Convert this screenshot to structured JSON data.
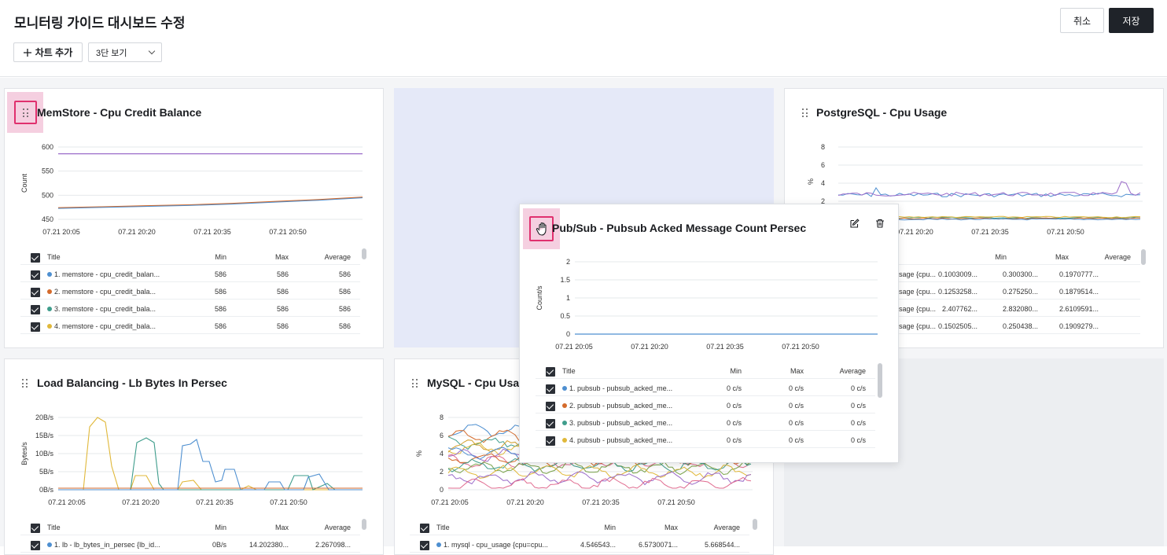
{
  "header": {
    "title": "모니터링 가이드 대시보드 수정",
    "cancel_label": "취소",
    "save_label": "저장"
  },
  "toolbar": {
    "add_chart_label": "차트 추가",
    "add_icon": "plus-icon",
    "view_select_value": "3단 보기"
  },
  "colors": {
    "accent": "#1f2329",
    "highlight": "#e0306e",
    "placeholder": "#e5e9f8",
    "series": [
      "#4e8fd0",
      "#d46b2c",
      "#3f9d8c",
      "#e0b83a",
      "#9b6cc9"
    ]
  },
  "cards": {
    "memstore": {
      "title": "MemStore - Cpu Credit Balance",
      "chart_data": {
        "type": "line",
        "ylabel": "Count",
        "y_ticks": [
          "600",
          "550",
          "500",
          "450"
        ],
        "x_ticks": [
          "07.21 20:05",
          "07.21 20:20",
          "07.21 20:35",
          "07.21 20:50"
        ],
        "ylim": [
          450,
          600
        ],
        "series": [
          {
            "name": "1. memstore - cpu_credit_balan...",
            "values": [
              586,
              586,
              586,
              586,
              586,
              586,
              586,
              586
            ]
          },
          {
            "name": "2. memstore - cpu_credit_bala...",
            "values": [
              474,
              476,
              478,
              480,
              483,
              487,
              491,
              496
            ]
          }
        ]
      },
      "table": {
        "headers": [
          "Title",
          "Min",
          "Max",
          "Average"
        ],
        "rows": [
          [
            "1. memstore - cpu_credit_balan...",
            "586",
            "586",
            "586"
          ],
          [
            "2. memstore - cpu_credit_bala...",
            "586",
            "586",
            "586"
          ],
          [
            "3. memstore - cpu_credit_bala...",
            "586",
            "586",
            "586"
          ],
          [
            "4. memstore - cpu_credit_bala...",
            "586",
            "586",
            "586"
          ]
        ]
      }
    },
    "postgres": {
      "title": "PostgreSQL - Cpu Usage",
      "chart_data": {
        "type": "line",
        "ylabel": "%",
        "y_ticks": [
          "8",
          "6",
          "4",
          "2"
        ],
        "x_ticks": [
          "07.21 20:20",
          "07.21 20:35",
          "07.21 20:50"
        ],
        "ylim": [
          0,
          8
        ]
      },
      "table": {
        "headers": [
          "Min",
          "Max",
          "Average"
        ],
        "rows": [
          [
            "usage {cpu...",
            "0.1003009...",
            "0.300300...",
            "0.1970777..."
          ],
          [
            "usage {cpu...",
            "0.1253258...",
            "0.275250...",
            "0.1879514..."
          ],
          [
            "usage {cpu...",
            "2.407762...",
            "2.832080...",
            "2.6109591..."
          ],
          [
            "usage {cpu...",
            "0.1502505...",
            "0.250438...",
            "0.1909279..."
          ]
        ]
      }
    },
    "lb": {
      "title": "Load Balancing - Lb Bytes In Persec",
      "chart_data": {
        "type": "line",
        "ylabel": "Bytes/s",
        "y_ticks": [
          "20B/s",
          "15B/s",
          "10B/s",
          "5B/s",
          "0B/s"
        ],
        "x_ticks": [
          "07.21 20:05",
          "07.21 20:20",
          "07.21 20:35",
          "07.21 20:50"
        ],
        "ylim": [
          0,
          20
        ]
      },
      "table": {
        "headers": [
          "Title",
          "Min",
          "Max",
          "Average"
        ],
        "rows": [
          [
            "1. lb - lb_bytes_in_persec {lb_id...",
            "0B/s",
            "14.202380...",
            "2.267098..."
          ]
        ]
      }
    },
    "mysql": {
      "title": "MySQL - Cpu Usage",
      "chart_data": {
        "type": "line",
        "ylabel": "%",
        "y_ticks": [
          "8",
          "6",
          "4",
          "2",
          "0"
        ],
        "x_ticks": [
          "07.21 20:05",
          "07.21 20:20",
          "07.21 20:35",
          "07.21 20:50"
        ],
        "ylim": [
          0,
          8
        ]
      },
      "table": {
        "headers": [
          "Title",
          "Min",
          "Max",
          "Average"
        ],
        "rows": [
          [
            "1. mysql - cpu_usage {cpu=cpu...",
            "4.546543...",
            "6.5730071...",
            "5.668544..."
          ]
        ]
      }
    },
    "pubsub": {
      "title": "Pub/Sub - Pubsub Acked Message Count Persec",
      "edit_icon": "edit-icon",
      "delete_icon": "trash-icon",
      "drag_icon": "grab-hand-icon",
      "chart_data": {
        "type": "line",
        "ylabel": "Count/s",
        "y_ticks": [
          "2",
          "1.5",
          "1",
          "0.5",
          "0"
        ],
        "x_ticks": [
          "07.21 20:05",
          "07.21 20:20",
          "07.21 20:35",
          "07.21 20:50"
        ],
        "ylim": [
          0,
          2
        ],
        "series": [
          {
            "name": "1. pubsub - pubsub_acked_me...",
            "values": [
              0,
              0,
              0,
              0,
              0,
              0,
              0,
              0
            ]
          }
        ]
      },
      "table": {
        "headers": [
          "Title",
          "Min",
          "Max",
          "Average"
        ],
        "rows": [
          [
            "1. pubsub - pubsub_acked_me...",
            "0 c/s",
            "0 c/s",
            "0 c/s"
          ],
          [
            "2. pubsub - pubsub_acked_me...",
            "0 c/s",
            "0 c/s",
            "0 c/s"
          ],
          [
            "3. pubsub - pubsub_acked_me...",
            "0 c/s",
            "0 c/s",
            "0 c/s"
          ],
          [
            "4. pubsub - pubsub_acked_me...",
            "0 c/s",
            "0 c/s",
            "0 c/s"
          ]
        ]
      }
    }
  }
}
